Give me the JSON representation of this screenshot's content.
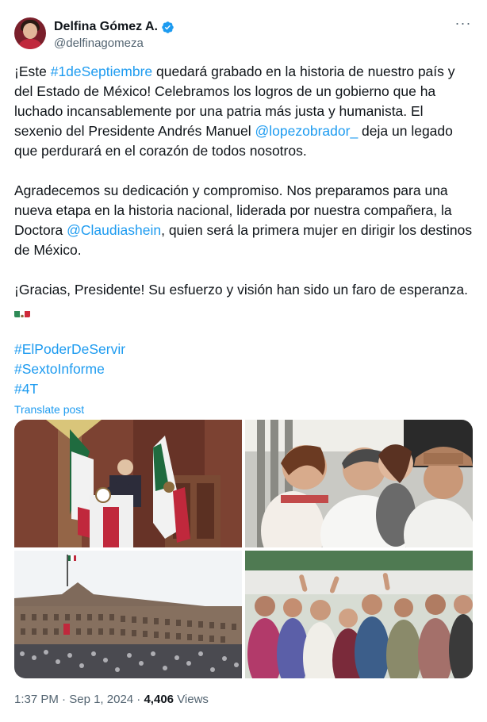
{
  "author": {
    "display_name": "Delfina Gómez A.",
    "handle": "@delfinagomeza"
  },
  "menu": {
    "more_label": "···"
  },
  "post": {
    "p1_a": "¡Este ",
    "p1_hashtag": "#1deSeptiembre",
    "p1_b": " quedará grabado en la historia de nuestro país y del Estado de México! Celebramos los logros de un gobierno que ha luchado incansablemente por una patria más justa y humanista. El sexenio del Presidente Andrés Manuel ",
    "p1_mention": "@lopezobrador_",
    "p1_c": " deja un legado que perdurará en el corazón de todos nosotros.",
    "p2_a": "Agradecemos su dedicación y compromiso. Nos preparamos para una nueva etapa en la historia nacional, liderada por nuestra compañera, la Doctora ",
    "p2_mention": "@Claudiashein",
    "p2_b": ", quien será la primera mujer en dirigir los destinos de México.",
    "p3": "¡Gracias, Presidente! Su esfuerzo y visión han sido un faro de esperanza.",
    "flag_icon": "mexico-flag-icon",
    "hashtags": [
      "#ElPoderDeServir",
      "#SextoInforme",
      "#4T"
    ],
    "translate_label": "Translate post"
  },
  "meta": {
    "time": "1:37 PM",
    "separator": "·",
    "date": "Sep 1, 2024",
    "views_count": "4,406",
    "views_label": "Views"
  },
  "colors": {
    "link": "#1d9bf0",
    "muted": "#536471",
    "text": "#0f1419"
  }
}
